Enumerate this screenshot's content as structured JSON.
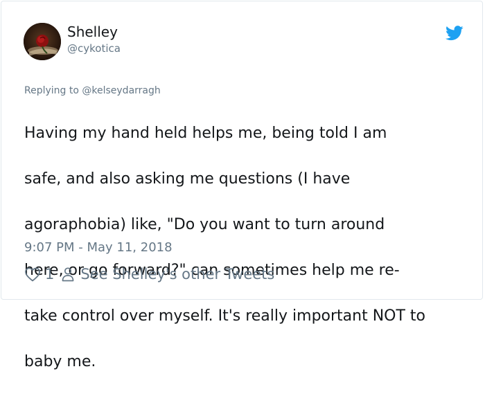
{
  "tweet": {
    "author": {
      "display_name": "Shelley",
      "handle": "@cykotica",
      "avatar_icon": "rose-avatar-photo"
    },
    "replying_to": "Replying to @kelseydarragh",
    "text_lines": [
      "Having my hand held helps me, being told I am",
      "safe, and also asking me questions (I have",
      "agoraphobia) like, \"Do you want to turn around",
      "here, or go forward?\" can sometimes help me re-",
      "take control over myself. It's really important NOT to",
      "baby me."
    ],
    "timestamp": "9:07 PM - May 11, 2018",
    "like_count": "1",
    "other_tweets_link": "See Shelley's other Tweets",
    "icons": {
      "brand": "twitter-bird-icon",
      "like": "heart-icon",
      "profile": "person-icon"
    },
    "colors": {
      "brand": "#1da1f2",
      "text": "#14171a",
      "secondary": "#657786",
      "border": "#e1e8ed"
    }
  }
}
